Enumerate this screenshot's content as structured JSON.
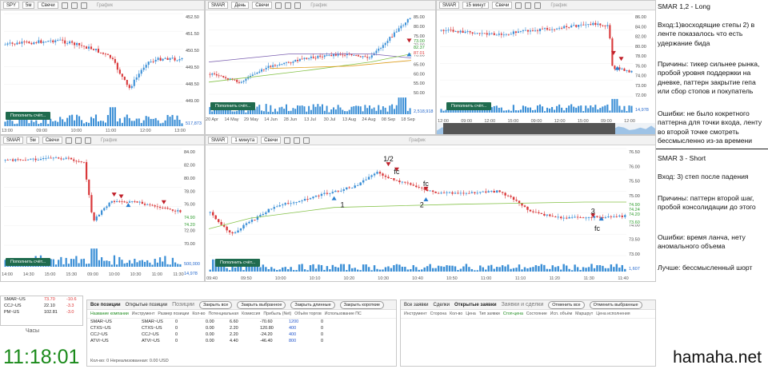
{
  "charts": [
    {
      "ticker": "SPY",
      "tf": "5м",
      "style": "Свечи",
      "graph": "График",
      "prices": [
        "452.50",
        "451.50",
        "450.50",
        "449.50",
        "448.50",
        "449.00"
      ],
      "times": [
        "13:00",
        "09:00",
        "10:00",
        "11:00",
        "12:00",
        "13:00"
      ],
      "vol": "517,873",
      "pb": "Пополнить счёт..."
    },
    {
      "ticker": "SMAR",
      "tf": "День",
      "style": "Свечи",
      "graph": "График",
      "prices": [
        "85.00",
        "80.00",
        "75.00",
        "73.00",
        "70.00",
        "65.00",
        "60.00",
        "55.00",
        "50.00"
      ],
      "hl": [
        "87.01",
        "82.37",
        "73.00"
      ],
      "times": [
        "20 Apr",
        "14 May",
        "29 May",
        "14 Jun",
        "28 Jun",
        "13 Jul",
        "30 Jul",
        "13 Aug",
        "24 Aug",
        "08 Sep",
        "18 Sep"
      ],
      "vol": "2,518,918",
      "pb": "Пополнить счёт..."
    },
    {
      "ticker": "SMAR",
      "tf": "15 минут",
      "style": "Свечи",
      "graph": "График",
      "prices": [
        "86.00",
        "84.00",
        "82.00",
        "80.00",
        "78.00",
        "76.00",
        "74.00",
        "73.00",
        "72.00"
      ],
      "times": [
        "12:00",
        "09:00",
        "12:00",
        "15:00",
        "09:00",
        "12:00",
        "15:00",
        "09:00",
        "12:00"
      ],
      "vol": "14,978",
      "pb": "Пополнить счёт..."
    },
    {
      "ticker": "SMAR",
      "tf": "5м",
      "style": "Свечи",
      "graph": "График",
      "prices": [
        "84.00",
        "82.00",
        "80.00",
        "78.00",
        "76.00",
        "74.00",
        "72.00",
        "70.00"
      ],
      "hl": [
        "74.90",
        "74.20"
      ],
      "times": [
        "14:00",
        "14:30",
        "15:00",
        "15:30",
        "09:00",
        "10:00",
        "10:30",
        "11:00",
        "11:30"
      ],
      "vol": "500,000",
      "vol2": "14,978",
      "pb": "Пополнить счёт..."
    },
    {
      "ticker": "SMAR",
      "tf": "1 минута",
      "style": "Свечи",
      "graph": "График",
      "prices": [
        "76.50",
        "76.00",
        "75.50",
        "75.00",
        "74.50",
        "74.00",
        "73.50",
        "73.00"
      ],
      "hl": [
        "74.90",
        "74.24",
        "74.20",
        "73.60"
      ],
      "times": [
        "09:40",
        "09:50",
        "10:00",
        "10:10",
        "10:20",
        "10:30",
        "10:40",
        "10:50",
        "11:00",
        "11:10",
        "11:20",
        "11:30",
        "11:40"
      ],
      "vol": "1,607",
      "pb": "Пополнить счёт...",
      "ann": [
        "1/2",
        "fc",
        "1",
        "fc",
        "2",
        "3",
        "fc"
      ]
    }
  ],
  "notes": {
    "long_title": "SMAR 1,2 - Long",
    "long_entry": "Вход:1)восходящие степы 2) в ленте показалось что есть удержание бида",
    "long_reasons": "Причины: тикер сильнее рынка, пробой уровня поддержки на дневке, паттерн закрытие гепа или сбор стопов и покупатель",
    "long_errors": "Ошибки: не было кокретного паттерна для точки входа, ленту во второй точке смотреть бессмысленно из-за времени",
    "short_title": "SMAR 3 - Short",
    "short_entry": "Вход: 3) степ после падения",
    "short_reasons": "Причины: паттерн второй шаг, пробой консолидации до этого",
    "short_errors": "Ошибки: время ланча, нету аномального объема",
    "short_better": "Лучше: бессмысленный шорт"
  },
  "watch": {
    "rows": [
      [
        "SMAR~US",
        "73.70",
        "-10.6"
      ],
      [
        "CCJ~US",
        "22.10",
        "-3.3"
      ],
      [
        "PM~US",
        "102.81",
        "-3.0"
      ]
    ],
    "clock_label": "Часы",
    "time": "11:18:01"
  },
  "positions": {
    "tabs": [
      "Все позиции",
      "Открытые позиции",
      "Позиции"
    ],
    "buttons": [
      "Закрыть все",
      "Закрыть выбранное",
      "Закрыть длинные",
      "Закрыть короткие"
    ],
    "cols": [
      "Название компании",
      "Инструмент",
      "Размер позиции",
      "Кол-во",
      "Потенциальная",
      "Комиссия",
      "Прибыль (Net)",
      "Объём торгов",
      "Использование ПС"
    ],
    "rows": [
      [
        "SMAR~US",
        "0",
        "0.00",
        "6.60",
        "-70.60",
        "1200",
        "0"
      ],
      [
        "CTXS~US",
        "0",
        "0.00",
        "2.20",
        "120.80",
        "400",
        "0"
      ],
      [
        "CCJ~US",
        "0",
        "0.00",
        "2.20",
        "-24.20",
        "400",
        "0"
      ],
      [
        "ATVI~US",
        "0",
        "0.00",
        "4.40",
        "-46.40",
        "800",
        "0"
      ]
    ],
    "footer": "Кол-во: 0   Нереализованная: 0.00 USD"
  },
  "orders": {
    "tabs": [
      "Все заявки",
      "Сделки",
      "Открытые заявки"
    ],
    "title": "Заявки и сделки",
    "buttons": [
      "Отменить все",
      "Отменить выбранные"
    ],
    "cols": [
      "Инструмент",
      "Сторона",
      "Кол-во",
      "Цена",
      "Тип заявки",
      "Стоп-цена",
      "Состояние",
      "Исп. объём",
      "Маршрут",
      "Цена исполнения"
    ]
  },
  "watermark": "hamaha.net",
  "colors": {
    "up": "#3b8fd6",
    "down": "#d9383a",
    "ma1": "#86c34a",
    "ma2": "#7b5fb0",
    "ma3": "#e0a020",
    "accent": "#1f6b4e"
  }
}
